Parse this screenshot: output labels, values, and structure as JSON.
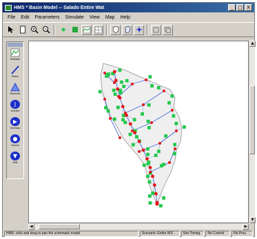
{
  "window": {
    "title": "HMS * Basin Model -- Salado Entire Wat",
    "controls": {
      "minimize": "_",
      "maximize": "□",
      "close": "X"
    }
  },
  "menu": {
    "items": [
      "File",
      "Edit",
      "Parameters",
      "Simulate",
      "View",
      "Map",
      "Help"
    ]
  },
  "toolbar": {
    "icons": [
      "arrow-pointer-icon",
      "page-icon",
      "zoom-in-icon",
      "zoom-out-icon",
      "green-dot-icon",
      "green-square-icon",
      "map-layer-icon",
      "grid-layer-icon",
      "shield-icon",
      "outline-icon",
      "star-icon",
      "box-icon",
      "copy-icon"
    ]
  },
  "palette": {
    "items": [
      {
        "label": "Subbasin",
        "icon": "subbasin-icon"
      },
      {
        "label": "Reach",
        "icon": "reach-icon"
      },
      {
        "label": "Reservoir",
        "icon": "reservoir-icon"
      },
      {
        "label": "Junction",
        "icon": "junction-icon"
      },
      {
        "label": "Diversion",
        "icon": "diversion-icon"
      },
      {
        "label": "Source",
        "icon": "source-icon"
      },
      {
        "label": "Sink",
        "icon": "sink-icon"
      }
    ]
  },
  "statusbar": {
    "message": "HMS: click and drag to pan the schematic model",
    "panes": [
      "Scenario: Entire WS",
      "Sim Timing",
      "No Control",
      "No Prec"
    ]
  },
  "colors": {
    "subbasin": "#22c84a",
    "junction": "#e01818",
    "reach": "#4a6adc",
    "boundary": "#909090",
    "title_start": "#0a246a",
    "title_end": "#3a6ea5"
  }
}
